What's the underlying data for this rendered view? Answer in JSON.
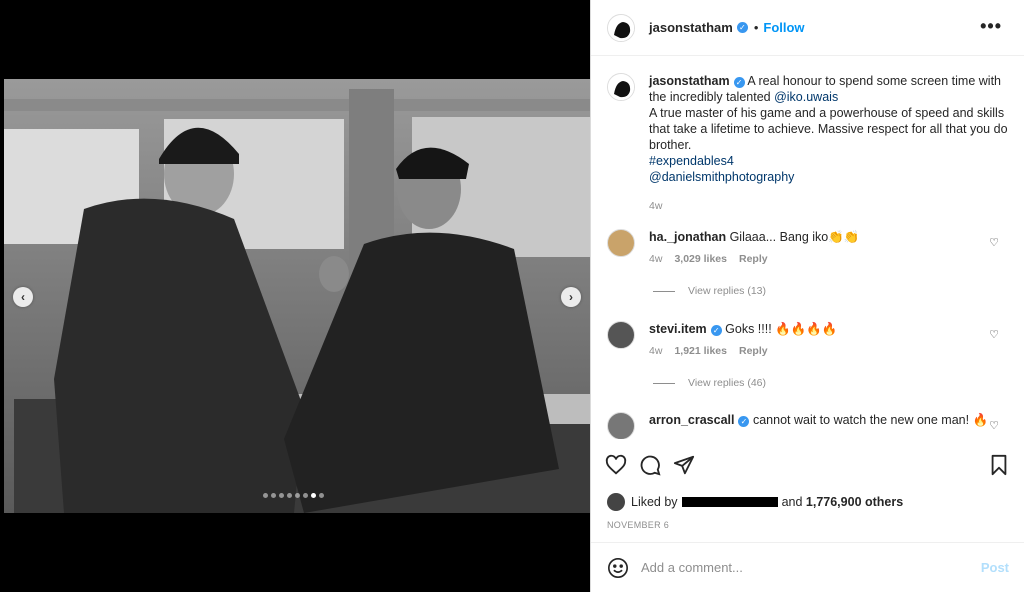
{
  "post": {
    "username": "jasonstatham",
    "follow_label": "Follow",
    "separator": "•",
    "more_label": "•••"
  },
  "caption": {
    "username": "jasonstatham",
    "line1": "A real honour to spend some screen time with the incredibly talented",
    "mention1": "@iko.uwais",
    "line2": "A true master of his game and a powerhouse of speed and skills that take a lifetime to achieve. Massive respect for all that you do brother.",
    "hashtag": "#expendables4",
    "mention2": "@danielsmithphotography",
    "age": "4w"
  },
  "comments": [
    {
      "username": "ha._jonathan",
      "text": "Gilaaa... Bang iko👏👏",
      "age": "4w",
      "likes": "3,029 likes",
      "reply": "Reply",
      "view_replies": "View replies (13)"
    },
    {
      "username": "stevi.item",
      "text": "Goks !!!! 🔥🔥🔥🔥",
      "age": "4w",
      "likes": "1,921 likes",
      "reply": "Reply",
      "view_replies": "View replies (46)"
    },
    {
      "username": "arron_crascall",
      "text": "cannot wait to watch the new one man! 🔥"
    }
  ],
  "likes": {
    "prefix": "Liked by",
    "connector": "and",
    "count": "1,776,900 others"
  },
  "date": "NOVEMBER 6",
  "add_comment": {
    "placeholder": "Add a comment...",
    "post_label": "Post"
  },
  "carousel": {
    "count": 8,
    "active_index": 6
  },
  "colors": {
    "accent": "#0095f6",
    "verified": "#3897f0",
    "text": "#262626",
    "muted": "#8e8e8e"
  },
  "icons": [
    "verified-icon",
    "more-options-icon",
    "heart-icon",
    "comment-icon",
    "share-icon",
    "bookmark-icon",
    "emoji-icon",
    "chevron-left-icon",
    "chevron-right-icon"
  ]
}
